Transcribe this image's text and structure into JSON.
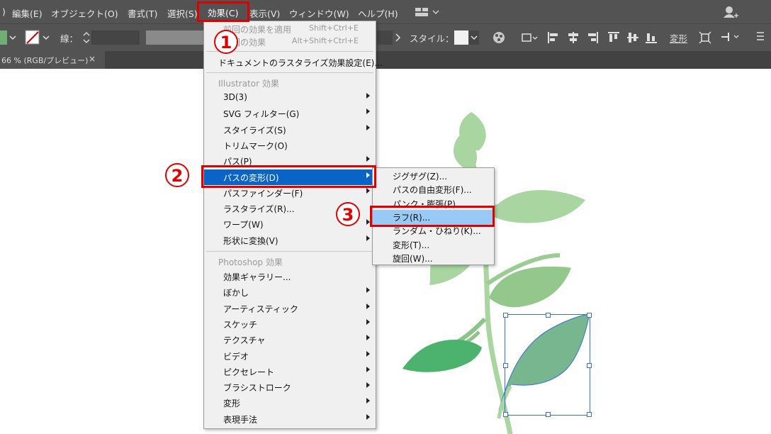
{
  "menubar": {
    "items": [
      ")",
      "編集(E)",
      "オブジェクト(O)",
      "書式(T)",
      "選択(S)",
      "効果(C)",
      "表示(V)",
      "ウィンドウ(W)",
      "ヘルプ(H)"
    ]
  },
  "toolbar": {
    "stroke_label": "線：",
    "style_label": "スタイル：",
    "transform_label": "変形"
  },
  "doc_tab": {
    "title": "66 % (RGB/プレビュー)",
    "close": "×"
  },
  "effect_menu": {
    "apply_last": "前回の効果を適用",
    "apply_last_shortcut": "Shift+Ctrl+E",
    "last_effect": "前回の効果",
    "last_effect_shortcut": "Alt+Shift+Ctrl+E",
    "raster_settings": "ドキュメントのラスタライズ効果設定(E)...",
    "illustrator_header": "Illustrator 効果",
    "illustrator_items": [
      {
        "label": "3D(3)",
        "sub": true
      },
      {
        "label": "SVG フィルター(G)",
        "sub": true
      },
      {
        "label": "スタイライズ(S)",
        "sub": true
      },
      {
        "label": "トリムマーク(O)",
        "sub": false
      },
      {
        "label": "パス(P)",
        "sub": true
      },
      {
        "label": "パスの変形(D)",
        "sub": true
      },
      {
        "label": "パスファインダー(F)",
        "sub": true
      },
      {
        "label": "ラスタライズ(R)...",
        "sub": false
      },
      {
        "label": "ワープ(W)",
        "sub": true
      },
      {
        "label": "形状に変換(V)",
        "sub": true
      }
    ],
    "photoshop_header": "Photoshop 効果",
    "photoshop_items": [
      {
        "label": "効果ギャラリー...",
        "sub": false
      },
      {
        "label": "ぼかし",
        "sub": true
      },
      {
        "label": "アーティスティック",
        "sub": true
      },
      {
        "label": "スケッチ",
        "sub": true
      },
      {
        "label": "テクスチャ",
        "sub": true
      },
      {
        "label": "ビデオ",
        "sub": true
      },
      {
        "label": "ピクセレート",
        "sub": true
      },
      {
        "label": "ブラシストローク",
        "sub": true
      },
      {
        "label": "変形",
        "sub": true
      },
      {
        "label": "表現手法",
        "sub": true
      }
    ]
  },
  "submenu": {
    "items": [
      "ジグザグ(Z)...",
      "パスの自由変形(F)...",
      "パンク・膨張(P)...",
      "ラフ(R)...",
      "ランダム・ひねり(K)...",
      "変形(T)...",
      "旋回(W)..."
    ]
  },
  "annotations": {
    "step1": "1",
    "step2": "2",
    "step3": "3",
    "color": "#e00000"
  },
  "colors": {
    "menu_highlight": "#0a64c8",
    "submenu_highlight": "#99c9f5",
    "leaf_light": "#a8d5a0",
    "leaf_mid": "#8cc48a",
    "leaf_dark": "#4cb36e",
    "leaf_selected": "#77b68e",
    "selection": "#3a6fd8"
  }
}
